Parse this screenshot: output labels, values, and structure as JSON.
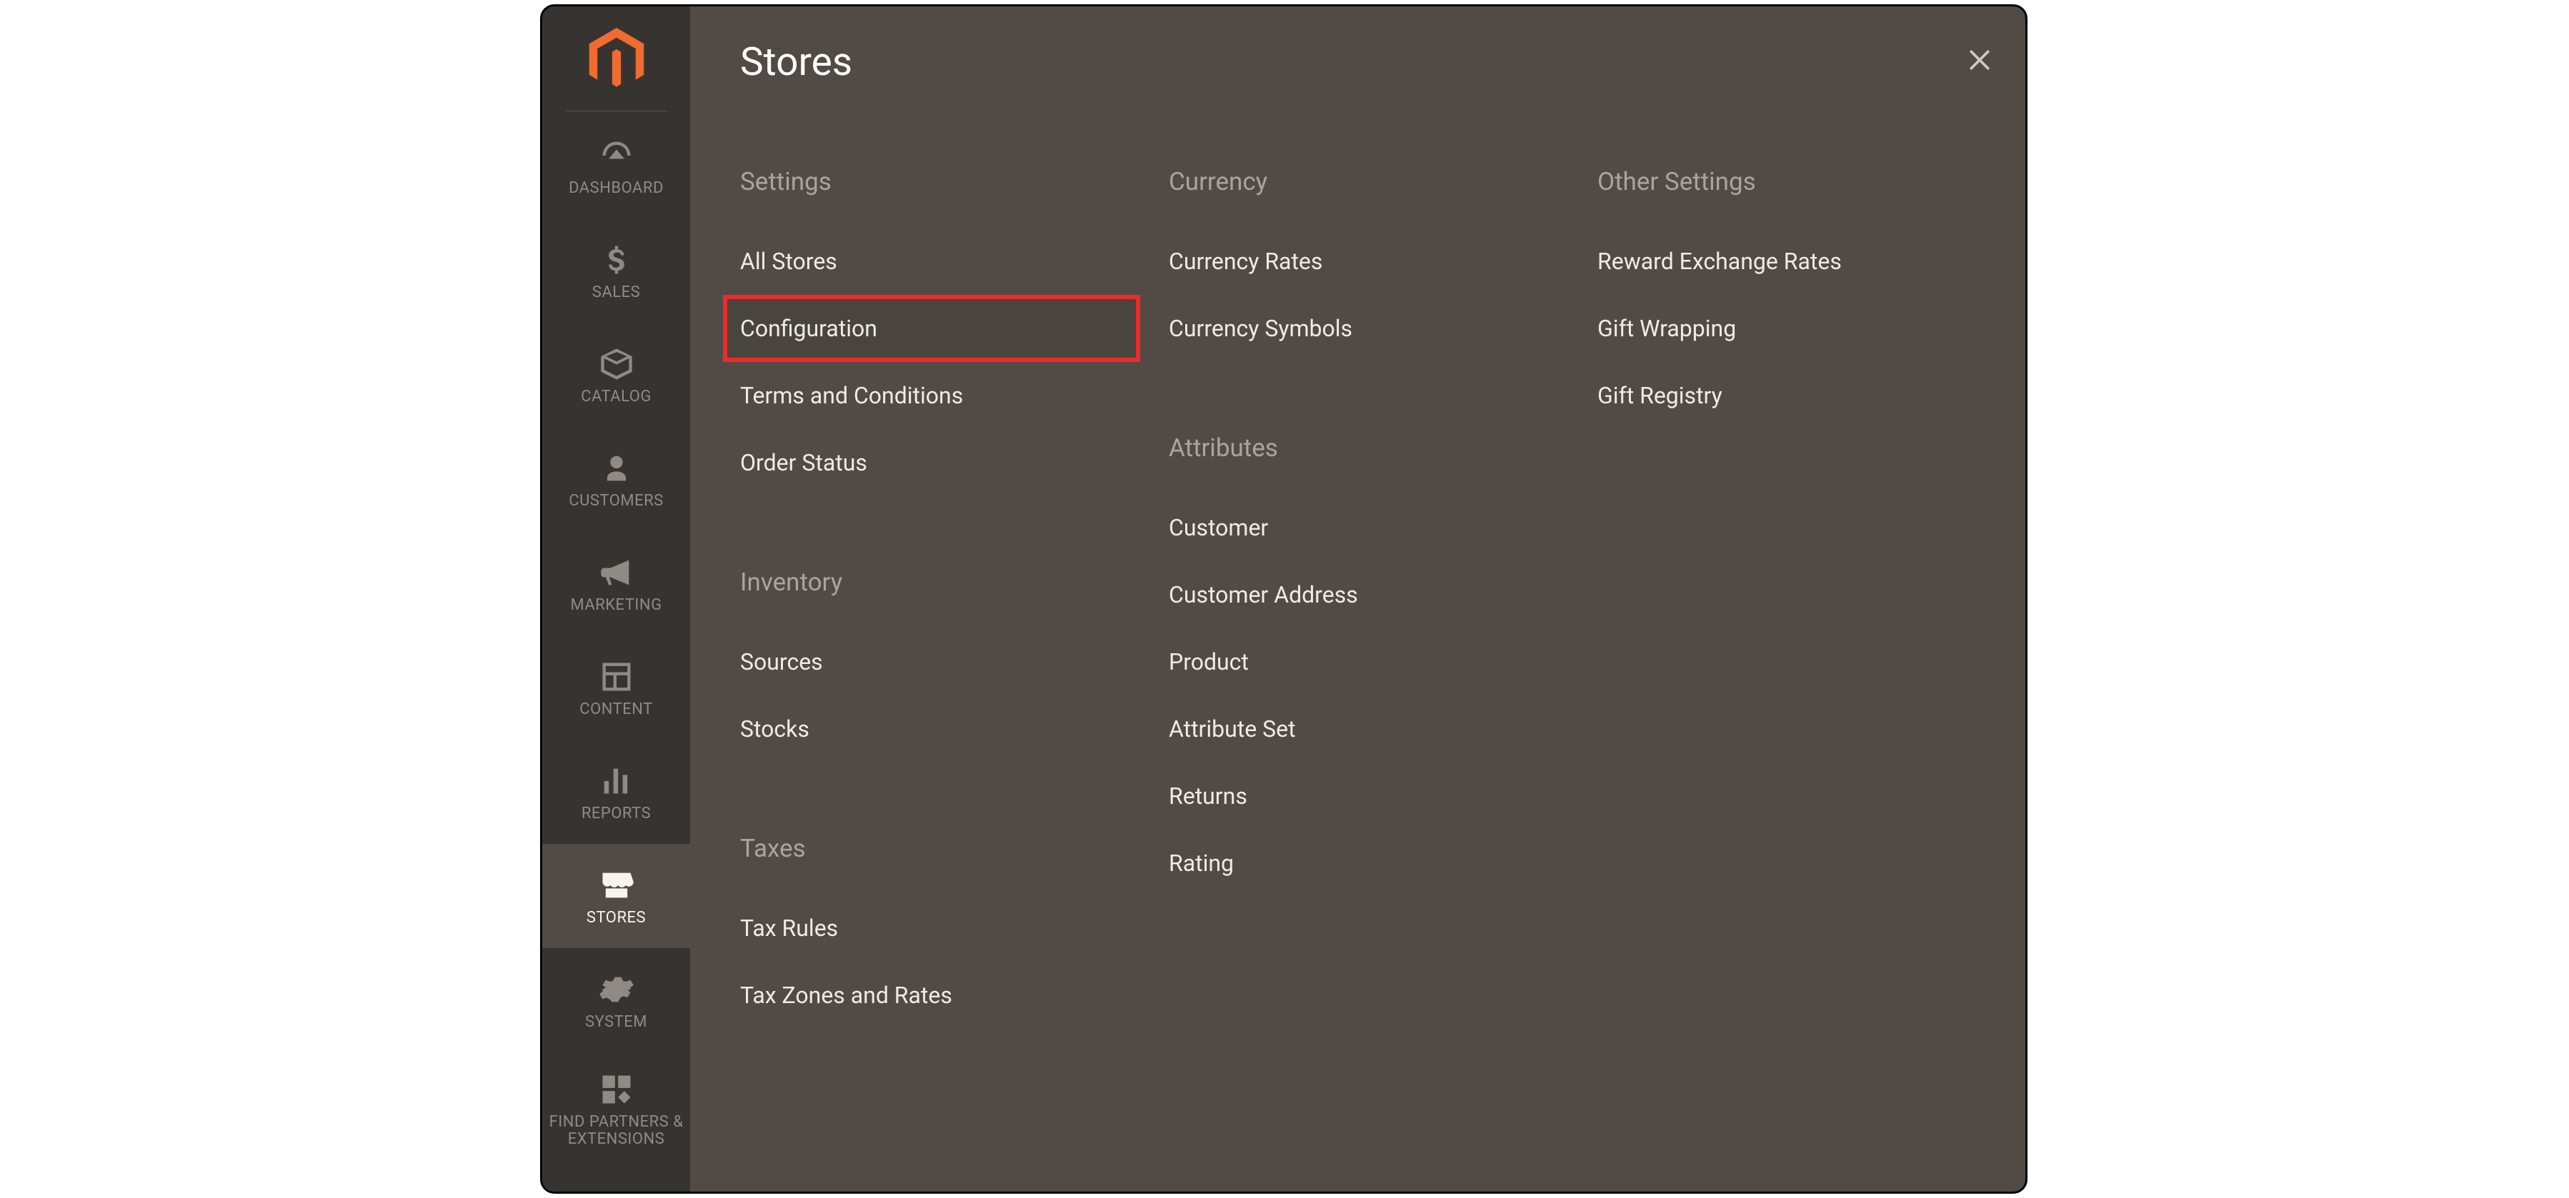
{
  "sidenav": {
    "items": [
      {
        "id": "dashboard",
        "label": "DASHBOARD",
        "icon": "dashboard-icon"
      },
      {
        "id": "sales",
        "label": "SALES",
        "icon": "dollar-icon"
      },
      {
        "id": "catalog",
        "label": "CATALOG",
        "icon": "box-icon"
      },
      {
        "id": "customers",
        "label": "CUSTOMERS",
        "icon": "person-icon"
      },
      {
        "id": "marketing",
        "label": "MARKETING",
        "icon": "megaphone-icon"
      },
      {
        "id": "content",
        "label": "CONTENT",
        "icon": "layout-icon"
      },
      {
        "id": "reports",
        "label": "REPORTS",
        "icon": "bar-chart-icon"
      },
      {
        "id": "stores",
        "label": "STORES",
        "icon": "storefront-icon",
        "active": true
      },
      {
        "id": "system",
        "label": "SYSTEM",
        "icon": "gear-icon"
      },
      {
        "id": "find-partners",
        "label": "FIND PARTNERS & EXTENSIONS",
        "icon": "blocks-icon"
      }
    ]
  },
  "flyout": {
    "title": "Stores",
    "columns": [
      {
        "groups": [
          {
            "heading": "Settings",
            "links": [
              {
                "label": "All Stores"
              },
              {
                "label": "Configuration",
                "highlight": true
              },
              {
                "label": "Terms and Conditions"
              },
              {
                "label": "Order Status"
              }
            ]
          },
          {
            "heading": "Inventory",
            "links": [
              {
                "label": "Sources"
              },
              {
                "label": "Stocks"
              }
            ]
          },
          {
            "heading": "Taxes",
            "links": [
              {
                "label": "Tax Rules"
              },
              {
                "label": "Tax Zones and Rates"
              }
            ]
          }
        ]
      },
      {
        "groups": [
          {
            "heading": "Currency",
            "links": [
              {
                "label": "Currency Rates"
              },
              {
                "label": "Currency Symbols"
              }
            ]
          },
          {
            "heading": "Attributes",
            "links": [
              {
                "label": "Customer"
              },
              {
                "label": "Customer Address"
              },
              {
                "label": "Product"
              },
              {
                "label": "Attribute Set"
              },
              {
                "label": "Returns"
              },
              {
                "label": "Rating"
              }
            ]
          }
        ]
      },
      {
        "groups": [
          {
            "heading": "Other Settings",
            "links": [
              {
                "label": "Reward Exchange Rates"
              },
              {
                "label": "Gift Wrapping"
              },
              {
                "label": "Gift Registry"
              }
            ]
          }
        ]
      }
    ]
  },
  "highlight_color": "#ef2a2a",
  "brand_color": "#ef6b2f"
}
